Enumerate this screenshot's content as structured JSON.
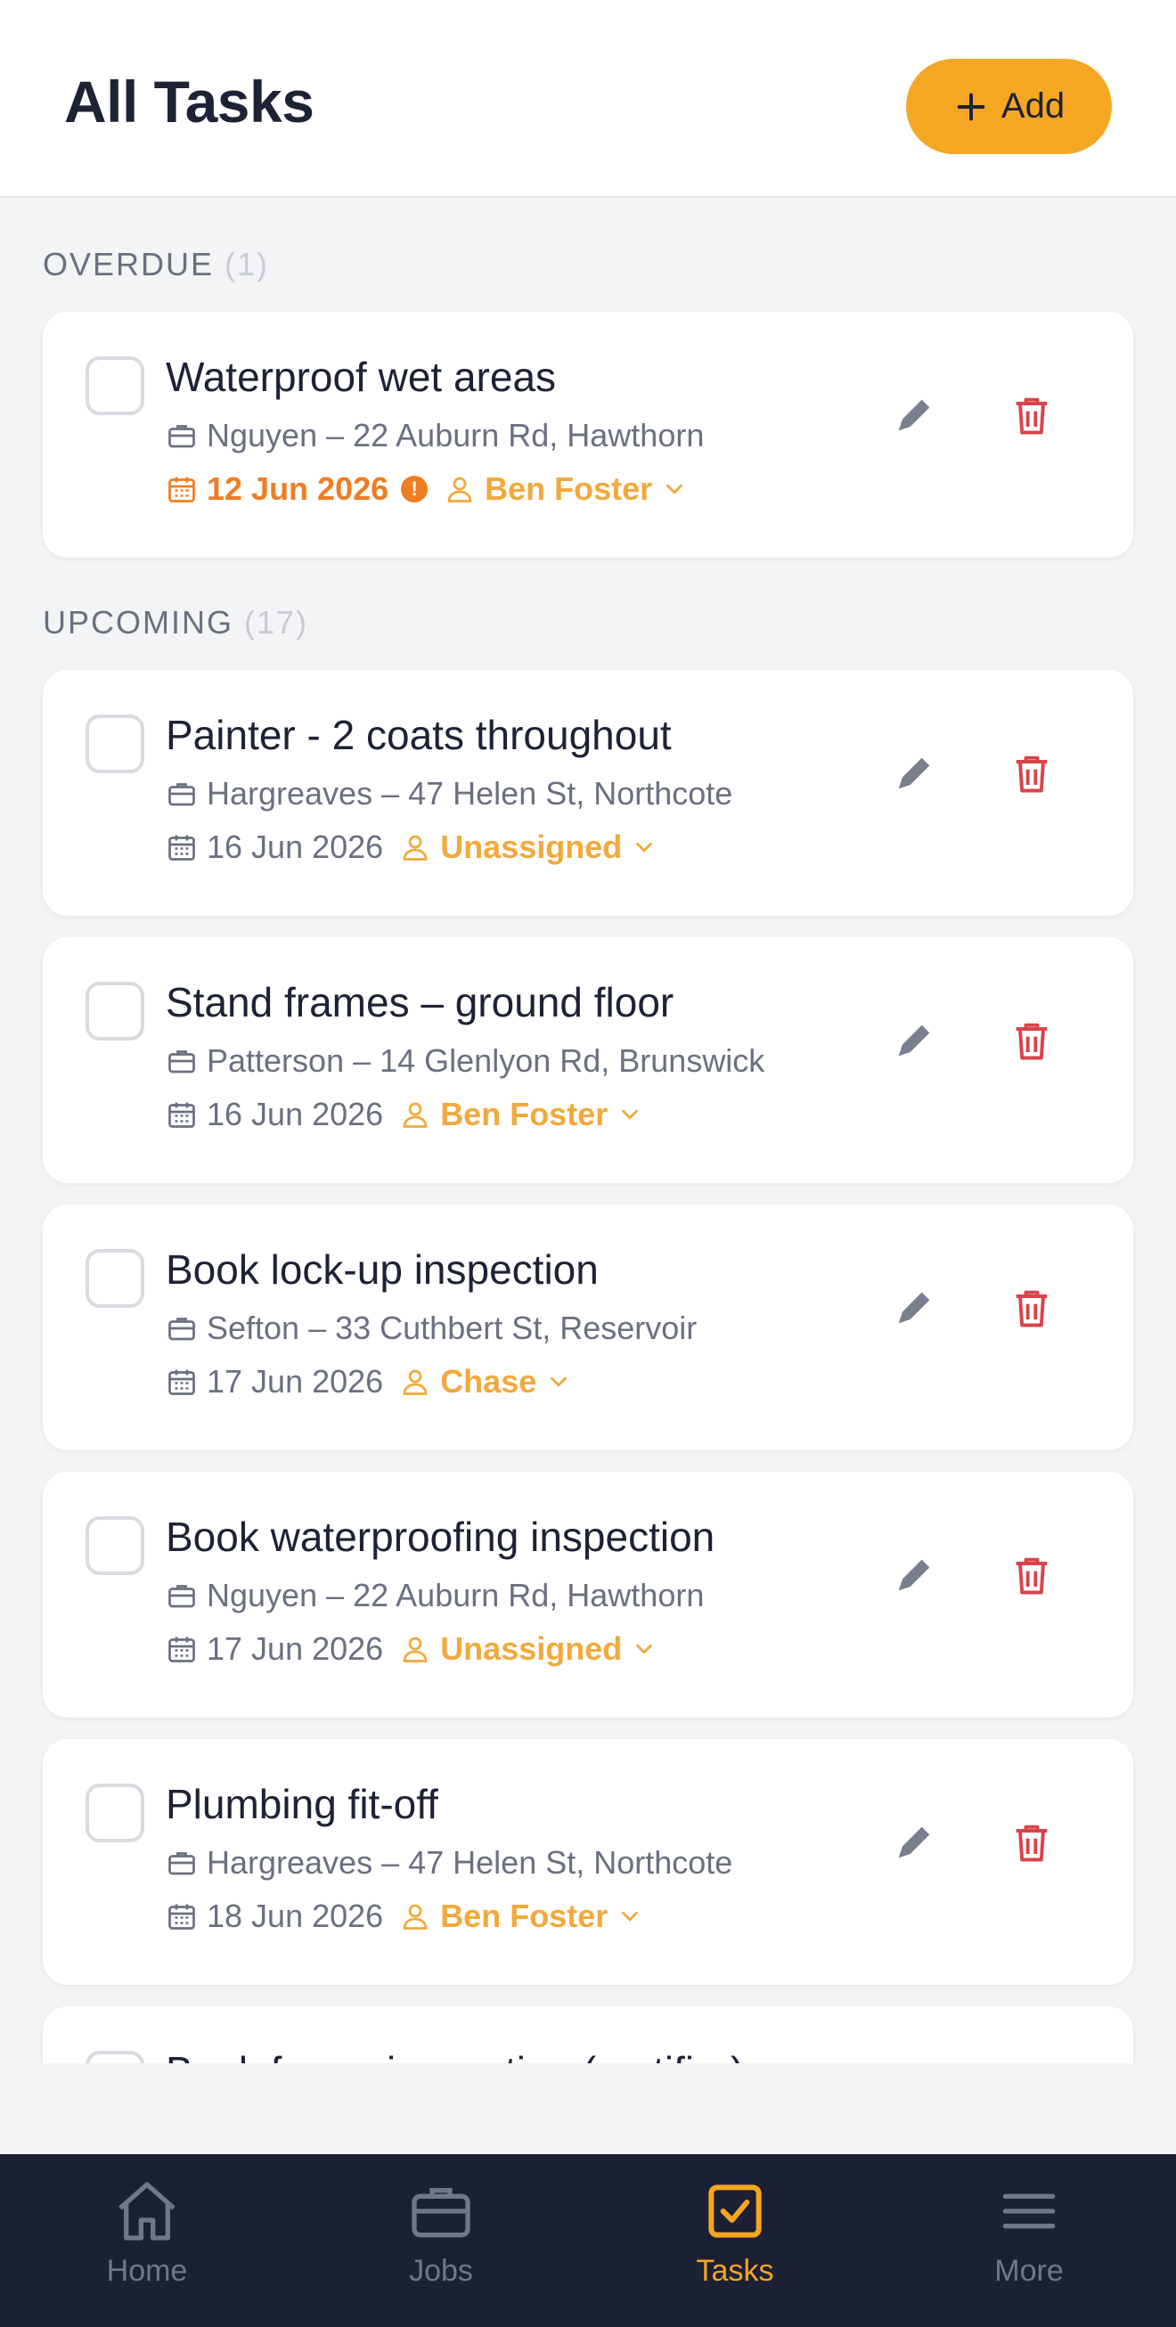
{
  "header": {
    "title": "All Tasks",
    "add_label": "Add",
    "accent": "#f5a623"
  },
  "sections": {
    "overdue": {
      "label": "OVERDUE",
      "count": "(1)"
    },
    "upcoming": {
      "label": "UPCOMING",
      "count": "(17)"
    }
  },
  "overdue_tasks": [
    {
      "title": "Waterproof wet areas",
      "job": "Nguyen – 22 Auburn Rd, Hawthorn",
      "date": "12 Jun 2026",
      "assignee": "Ben Foster",
      "overdue_flag": "!"
    }
  ],
  "upcoming_tasks": [
    {
      "title": "Painter - 2 coats throughout",
      "job": "Hargreaves – 47 Helen St, Northcote",
      "date": "16 Jun 2026",
      "assignee": "Unassigned"
    },
    {
      "title": "Stand frames – ground floor",
      "job": "Patterson – 14 Glenlyon Rd, Brunswick",
      "date": "16 Jun 2026",
      "assignee": "Ben Foster"
    },
    {
      "title": "Book lock-up inspection",
      "job": "Sefton – 33 Cuthbert St, Reservoir",
      "date": "17 Jun 2026",
      "assignee": "Chase"
    },
    {
      "title": "Book waterproofing inspection",
      "job": "Nguyen – 22 Auburn Rd, Hawthorn",
      "date": "17 Jun 2026",
      "assignee": "Unassigned"
    },
    {
      "title": "Plumbing fit-off",
      "job": "Hargreaves – 47 Helen St, Northcote",
      "date": "18 Jun 2026",
      "assignee": "Ben Foster"
    },
    {
      "title": "Book frame inspection (certifier)"
    }
  ],
  "nav": {
    "items": [
      {
        "label": "Home",
        "icon": "home-icon"
      },
      {
        "label": "Jobs",
        "icon": "briefcase-icon"
      },
      {
        "label": "Tasks",
        "icon": "task-check-icon",
        "active": true
      },
      {
        "label": "More",
        "icon": "menu-icon"
      }
    ]
  },
  "colors": {
    "assignee": "#f2a93b",
    "overdue": "#ef7d22",
    "delete": "#d9434a",
    "nav_bg": "#1c2035"
  }
}
